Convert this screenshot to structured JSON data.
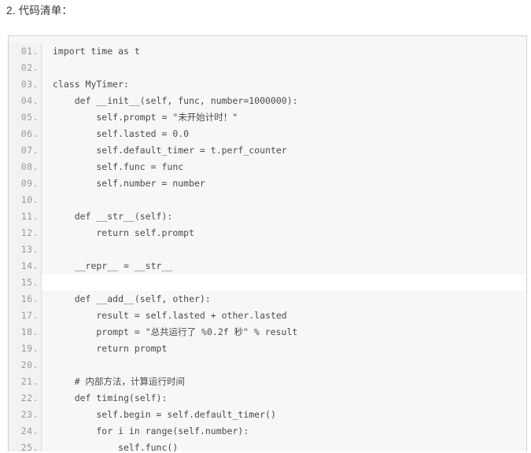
{
  "heading": "2. 代码清单：",
  "code": {
    "language": "python",
    "highlighted_line": 15,
    "lines": [
      {
        "no": "01.",
        "text": "import time as t"
      },
      {
        "no": "02.",
        "text": ""
      },
      {
        "no": "03.",
        "text": "class MyTimer:"
      },
      {
        "no": "04.",
        "text": "    def __init__(self, func, number=1000000):"
      },
      {
        "no": "05.",
        "text": "        self.prompt = \"未开始计时！\""
      },
      {
        "no": "06.",
        "text": "        self.lasted = 0.0"
      },
      {
        "no": "07.",
        "text": "        self.default_timer = t.perf_counter"
      },
      {
        "no": "08.",
        "text": "        self.func = func"
      },
      {
        "no": "09.",
        "text": "        self.number = number"
      },
      {
        "no": "10.",
        "text": ""
      },
      {
        "no": "11.",
        "text": "    def __str__(self):"
      },
      {
        "no": "12.",
        "text": "        return self.prompt"
      },
      {
        "no": "13.",
        "text": ""
      },
      {
        "no": "14.",
        "text": "    __repr__ = __str__"
      },
      {
        "no": "15.",
        "text": ""
      },
      {
        "no": "16.",
        "text": "    def __add__(self, other):"
      },
      {
        "no": "17.",
        "text": "        result = self.lasted + other.lasted"
      },
      {
        "no": "18.",
        "text": "        prompt = \"总共运行了 %0.2f 秒\" % result"
      },
      {
        "no": "19.",
        "text": "        return prompt"
      },
      {
        "no": "20.",
        "text": ""
      },
      {
        "no": "21.",
        "text": "    # 内部方法，计算运行时间"
      },
      {
        "no": "22.",
        "text": "    def timing(self):"
      },
      {
        "no": "23.",
        "text": "        self.begin = self.default_timer()"
      },
      {
        "no": "24.",
        "text": "        for i in range(self.number):"
      },
      {
        "no": "25.",
        "text": "            self.func()"
      }
    ]
  },
  "colors": {
    "page_background": "#ffffff",
    "code_background": "#f7f7f7",
    "gutter_background": "#f2f2f2",
    "border": "#cfcfcf",
    "gutter_separator": "#dedede",
    "code_text": "#4a4a4a",
    "line_number_text": "#999999",
    "heading_text": "#333333",
    "highlight_row": "#ffffff"
  }
}
